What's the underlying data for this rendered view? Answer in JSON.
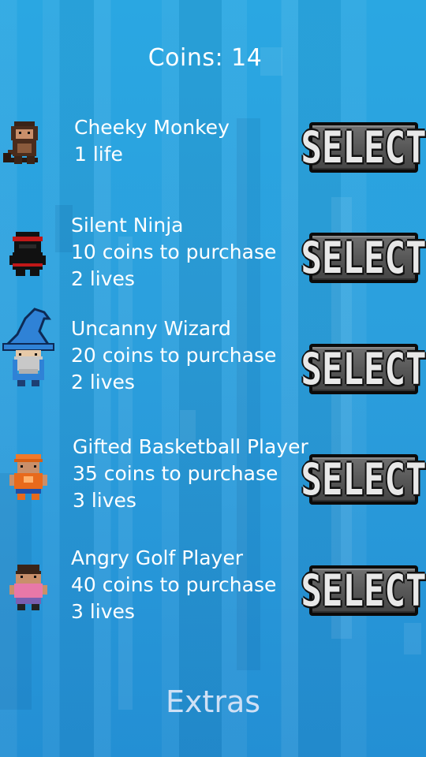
{
  "header": {
    "coins_text": "Coins: 14"
  },
  "characters": [
    {
      "name": "Cheeky Monkey",
      "line2": "1 life",
      "line3": "",
      "button_label": "SELECT",
      "icon": "monkey-icon"
    },
    {
      "name": "Silent Ninja",
      "line2": "10 coins to purchase",
      "line3": "2 lives",
      "button_label": "SELECT",
      "icon": "ninja-icon"
    },
    {
      "name": "Uncanny Wizard",
      "line2": "20 coins to purchase",
      "line3": "2 lives",
      "button_label": "SELECT",
      "icon": "wizard-icon"
    },
    {
      "name": "Gifted Basketball Player",
      "line2": "35 coins to purchase",
      "line3": "3 lives",
      "button_label": "SELECT",
      "icon": "basketball-player-icon"
    },
    {
      "name": "Angry Golf Player",
      "line2": "40 coins to purchase",
      "line3": "3 lives",
      "button_label": "SELECT",
      "icon": "golf-player-icon"
    }
  ],
  "footer": {
    "extras_label": "Extras"
  },
  "colors": {
    "background": "#29a3df",
    "text": "#ffffff",
    "extras_text": "#cfe0f5",
    "button_face": "#5f5f5f",
    "button_border": "#0b0b0b"
  }
}
